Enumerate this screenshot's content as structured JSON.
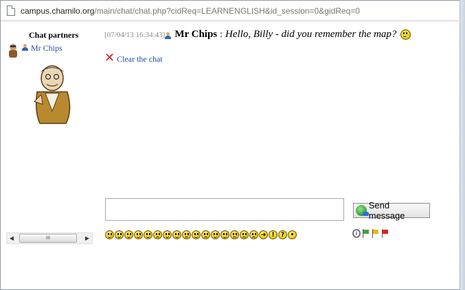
{
  "browser": {
    "url_host": "campus.chamilo.org",
    "url_path": "/main/chat/chat.php?cidReq=LEARNENGLISH&id_session=0&gidReq=0"
  },
  "sidebar": {
    "title": "Chat partners",
    "partners": [
      {
        "name": "Mr Chips"
      }
    ],
    "scrollbar_thumb": "III"
  },
  "messages": [
    {
      "timestamp": "[07/04/13 16:34:43]",
      "author": "Mr Chips",
      "separator": ":",
      "text": "Hello, Billy - did you remember the map?",
      "trailing_icon": "smiley-icon"
    }
  ],
  "actions": {
    "clear_chat_label": "Clear the chat",
    "send_label": "Send message"
  },
  "input": {
    "value": "",
    "placeholder": ""
  },
  "emoticons": [
    "smile",
    "grin",
    "happy",
    "tongue",
    "cool",
    "surprised",
    "angel",
    "wink",
    "confused",
    "neutral",
    "sad",
    "blush",
    "crazy",
    "frown",
    "worried",
    "angry",
    "arrow",
    "exclamation",
    "question",
    "idea"
  ],
  "status_icons": [
    "info",
    "green-flag",
    "yellow-flag",
    "red-flag"
  ],
  "colors": {
    "link": "#1f4f9f",
    "timestamp": "#888888",
    "clear_icon": "#e01e1e",
    "flag_green": "#3aa63a",
    "flag_yellow": "#f0b400",
    "flag_red": "#e01e1e"
  }
}
